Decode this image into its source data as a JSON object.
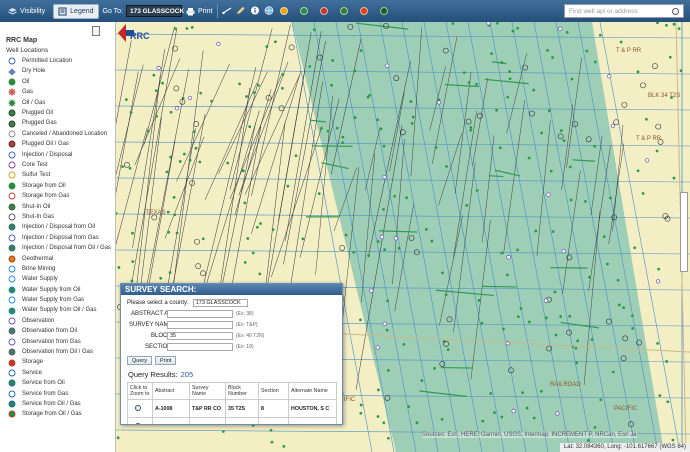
{
  "toolbar": {
    "visibility_label": "Visibility",
    "legend_label": "Legend",
    "goto_label": "Go To:",
    "goto_value": "173 GLASSCOCK",
    "print_label": "Print",
    "search_placeholder": "Find well api or address",
    "status_colors": [
      "#e8a317",
      "#2e8b3e",
      "#c0392b",
      "#2e7d32",
      "#d84315",
      "#1b5e20"
    ]
  },
  "legend": {
    "title": "RRC Map",
    "subtitle": "Well Locations",
    "items": [
      {
        "label": "Permitted Location",
        "icon": "circle-outline-blue"
      },
      {
        "label": "Dry Hole",
        "icon": "dry-hole-symbol"
      },
      {
        "label": "Oil",
        "icon": "green-dot"
      },
      {
        "label": "Gas",
        "icon": "gas-symbol"
      },
      {
        "label": "Oil / Gas",
        "icon": "oil-gas-symbol"
      },
      {
        "label": "Plugged Oil",
        "icon": "plugged-oil-symbol"
      },
      {
        "label": "Plugged Gas",
        "icon": "plugged-gas-symbol"
      },
      {
        "label": "Canceled / Abandoned Location",
        "icon": "canceled-symbol"
      },
      {
        "label": "Plugged Oil / Gas",
        "icon": "plugged-oil-gas-symbol"
      },
      {
        "label": "Injection / Disposal",
        "icon": "injection-symbol"
      },
      {
        "label": "Core Test",
        "icon": "core-test-symbol"
      },
      {
        "label": "Sulfur Test",
        "icon": "sulfur-test-symbol"
      },
      {
        "label": "Storage from Oil",
        "icon": "storage-oil-symbol"
      },
      {
        "label": "Storage from Gas",
        "icon": "storage-gas-symbol"
      },
      {
        "label": "Shut-In Oil",
        "icon": "shut-in-oil-symbol"
      },
      {
        "label": "Shut-In Gas",
        "icon": "shut-in-gas-symbol"
      },
      {
        "label": "Injection / Disposal from Oil",
        "icon": "injection-oil-symbol"
      },
      {
        "label": "Injection / Disposal from Gas",
        "icon": "injection-gas-symbol"
      },
      {
        "label": "Injection / Disposal from Oil / Gas",
        "icon": "injection-oil-gas-symbol"
      },
      {
        "label": "Geothermal",
        "icon": "geothermal-symbol"
      },
      {
        "label": "Brine Mining",
        "icon": "brine-mining-symbol"
      },
      {
        "label": "Water Supply",
        "icon": "water-supply-symbol"
      },
      {
        "label": "Water Supply from Oil",
        "icon": "water-supply-oil-symbol"
      },
      {
        "label": "Water Supply from Gas",
        "icon": "water-supply-gas-symbol"
      },
      {
        "label": "Water Supply from Oil / Gas",
        "icon": "water-supply-oil-gas-symbol"
      },
      {
        "label": "Observation",
        "icon": "observation-symbol"
      },
      {
        "label": "Observation from Oil",
        "icon": "observation-oil-symbol"
      },
      {
        "label": "Observation from Gas",
        "icon": "observation-gas-symbol"
      },
      {
        "label": "Observation from Oil / Gas",
        "icon": "observation-oil-gas-symbol"
      },
      {
        "label": "Storage",
        "icon": "storage-symbol"
      },
      {
        "label": "Service",
        "icon": "service-symbol"
      },
      {
        "label": "Service from Oil",
        "icon": "service-oil-symbol"
      },
      {
        "label": "Service from Gas",
        "icon": "service-gas-symbol"
      },
      {
        "label": "Service from Oil / Gas",
        "icon": "service-oil-gas-symbol"
      },
      {
        "label": "Storage from Oil / Gas",
        "icon": "storage-oil-gas-symbol"
      }
    ]
  },
  "map": {
    "labels": [
      "T & P RR",
      "BLK 34 T2S",
      "T & P RR",
      "TEXAS",
      "RAILROAD",
      "PACIFIC",
      "PACIFIC"
    ],
    "attribution": "Sources: Esri, HERE, Garmin, USGS, Intermap, INCREMENT P, NRCan, Esri Ja",
    "coordinates": "Lat: 32.084360, Long: -101.617667 (WGS 84)",
    "logo_text": "RRC"
  },
  "survey": {
    "title": "SURVEY SEARCH:",
    "county_label": "Please select a county:",
    "county_value": "173 GLASSCOCK",
    "fields": [
      {
        "label": "ABSTRACT A-",
        "value": "",
        "hint": "(Ex: 38)"
      },
      {
        "label": "SURVEY NAME",
        "value": "",
        "hint": "(Ex: T&P)"
      },
      {
        "label": "BLOCK",
        "value": "35",
        "hint": "(Ex: 40 T2N)"
      },
      {
        "label": "SECTION",
        "value": "",
        "hint": "(Ex: 19)"
      }
    ],
    "query_label": "Query",
    "print_label": "Print",
    "results_label": "Query Results:",
    "results_count": "205",
    "columns": [
      "Click to Zoom to",
      "Abstract",
      "Survey Name",
      "Block Number",
      "Section",
      "Alternate Name"
    ],
    "rows": [
      {
        "abstract": "A-1008",
        "survey": "T&P RR CO",
        "block": "35 T2S",
        "section": "8",
        "alt": "HOUSTON, S C"
      },
      {
        "abstract": "A-1009",
        "survey": "T&P RR CO",
        "block": "35 T2S",
        "section": "4",
        "alt": "HOUSTON, S C"
      }
    ]
  }
}
